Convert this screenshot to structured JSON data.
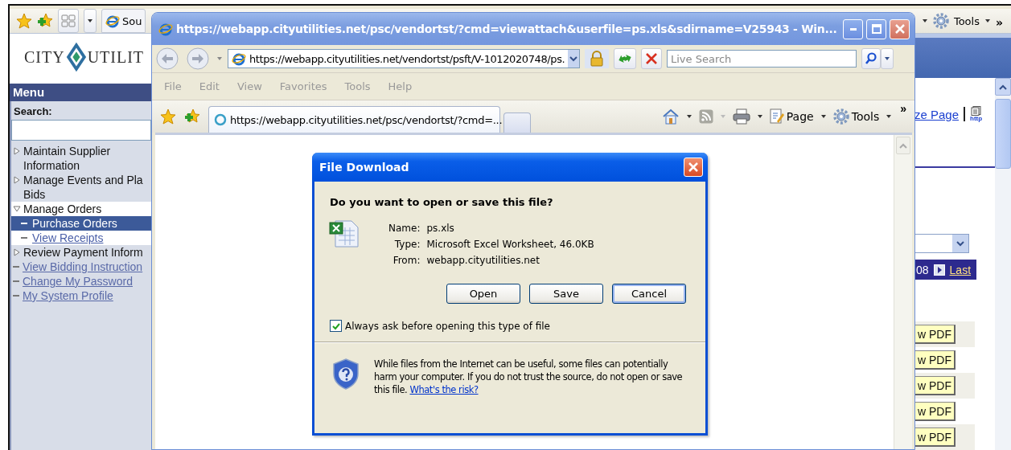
{
  "background_browser": {
    "command_bar": {
      "tab_label": "Sou",
      "tools_label": "Tools",
      "chevron": "»"
    },
    "logo": {
      "left": "CITY",
      "right": "UTILIT"
    },
    "menu": {
      "title": "Menu",
      "search_label": "Search:",
      "items": [
        {
          "kind": "folder",
          "lines": [
            "Maintain Supplier",
            "Information"
          ],
          "expanded": false
        },
        {
          "kind": "folder",
          "lines": [
            "Manage Events and Pla",
            "Bids"
          ],
          "expanded": false
        },
        {
          "kind": "folder",
          "lines": [
            "Manage Orders"
          ],
          "expanded": true,
          "children": [
            {
              "label": "Purchase Orders",
              "selected": true
            },
            {
              "label": "View Receipts",
              "selected": false
            }
          ]
        },
        {
          "kind": "folder",
          "lines": [
            "Review Payment Inform"
          ],
          "expanded": false
        },
        {
          "kind": "link",
          "lines": [
            "View Bidding Instruction"
          ]
        },
        {
          "kind": "link",
          "lines": [
            "Change My Password"
          ]
        },
        {
          "kind": "link",
          "lines": [
            "My System Profile"
          ]
        }
      ]
    },
    "page": {
      "link": "ze Page",
      "http_label": "http",
      "pager": {
        "number": "08",
        "last": "Last"
      },
      "pdf_buttons": [
        "w PDF",
        "w PDF",
        "w PDF",
        "w PDF",
        "w PDF"
      ]
    }
  },
  "popup": {
    "title": "https://webapp.cityutilities.net/psc/vendortst/?cmd=viewattach&userfile=ps.xls&sdirname=V25943 - Win...",
    "address": "https://webapp.cityutilities.net/vendortst/psft/V-1012020748/ps.",
    "search_placeholder": "Live Search",
    "menus": [
      "File",
      "Edit",
      "View",
      "Favorites",
      "Tools",
      "Help"
    ],
    "tab_label": "https://webapp.cityutilities.net/psc/vendortst/?cmd=...",
    "toolbar": {
      "page_label": "Page",
      "tools_label": "Tools",
      "chevron": "»"
    }
  },
  "dialog": {
    "title": "File Download",
    "question": "Do you want to open or save this file?",
    "details": [
      {
        "label": "Name:",
        "value": "ps.xls"
      },
      {
        "label": "Type:",
        "value": "Microsoft Excel Worksheet, 46.0KB"
      },
      {
        "label": "From:",
        "value": "webapp.cityutilities.net"
      }
    ],
    "buttons": [
      {
        "label": "Open",
        "focused": false
      },
      {
        "label": "Save",
        "focused": false
      },
      {
        "label": "Cancel",
        "focused": true
      }
    ],
    "checkbox": {
      "label": "Always ask before opening this type of file",
      "checked": true
    },
    "warning": {
      "text": "While files from the Internet can be useful, some files can potentially harm your computer. If you do not trust the source, do not open or save this file. ",
      "link": "What's the risk?"
    }
  }
}
